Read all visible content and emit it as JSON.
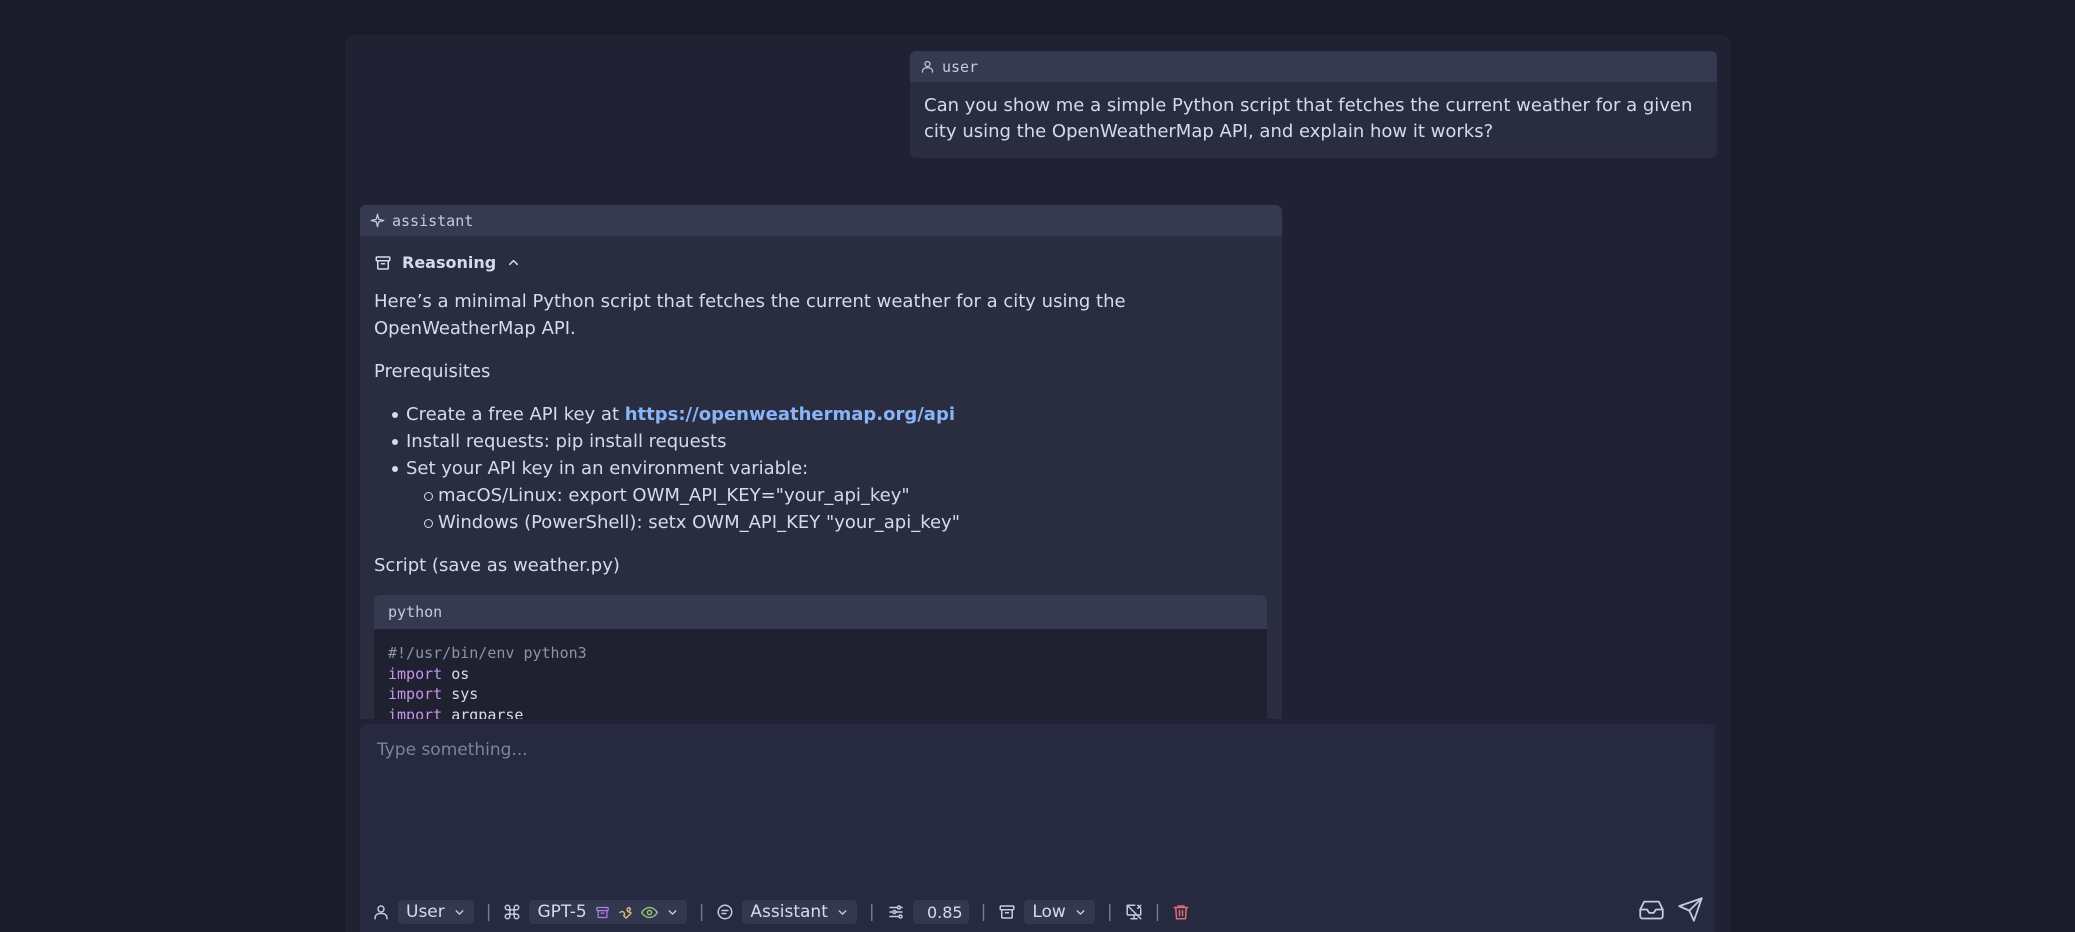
{
  "messages": {
    "user": {
      "role": "user",
      "text": "Can you show me a simple Python script that fetches the current weather for a given city using the OpenWeatherMap API, and explain how it works?"
    },
    "assistant": {
      "role": "assistant",
      "reasoning_label": "Reasoning",
      "intro": "Here’s a minimal Python script that fetches the current weather for a city using the OpenWeatherMap API.",
      "prerequisites_heading": "Prerequisites",
      "bullet1_prefix": "Create a free API key at ",
      "bullet1_link": "https://openweathermap.org/api",
      "bullet2": "Install requests: pip install requests",
      "bullet3": "Set your API key in an environment variable:",
      "sub1": "macOS/Linux: export OWM_API_KEY=\"your_api_key\"",
      "sub2": "Windows (PowerShell): setx OWM_API_KEY \"your_api_key\"",
      "script_heading": "Script (save as weather.py)",
      "code_lang": "python",
      "code_line1": "#!/usr/bin/env python3",
      "code_kw": "import",
      "code_mod1": " os",
      "code_mod2": " sys",
      "code_mod3": " argparse"
    }
  },
  "composer": {
    "placeholder": "Type something...",
    "role_select": "User",
    "model_select": "GPT-5",
    "persona_select": "Assistant",
    "temperature": "0.85",
    "reasoning_effort": "Low"
  },
  "colors": {
    "background": "#191b28",
    "panel": "#202233",
    "message": "#2a2d40",
    "link": "#8ab4f8",
    "keyword": "#c792ea",
    "danger": "#e06c75"
  },
  "icons": {
    "user": "user-icon",
    "assistant": "sparkle-icon",
    "reasoning": "archive-icon",
    "model": "command-icon",
    "persona": "message-circle-icon",
    "temperature": "sliders-icon",
    "effort": "archive-icon",
    "tools": "screen-share-off-icon",
    "delete": "trash-icon",
    "inbox": "inbox-icon",
    "send": "send-icon"
  }
}
